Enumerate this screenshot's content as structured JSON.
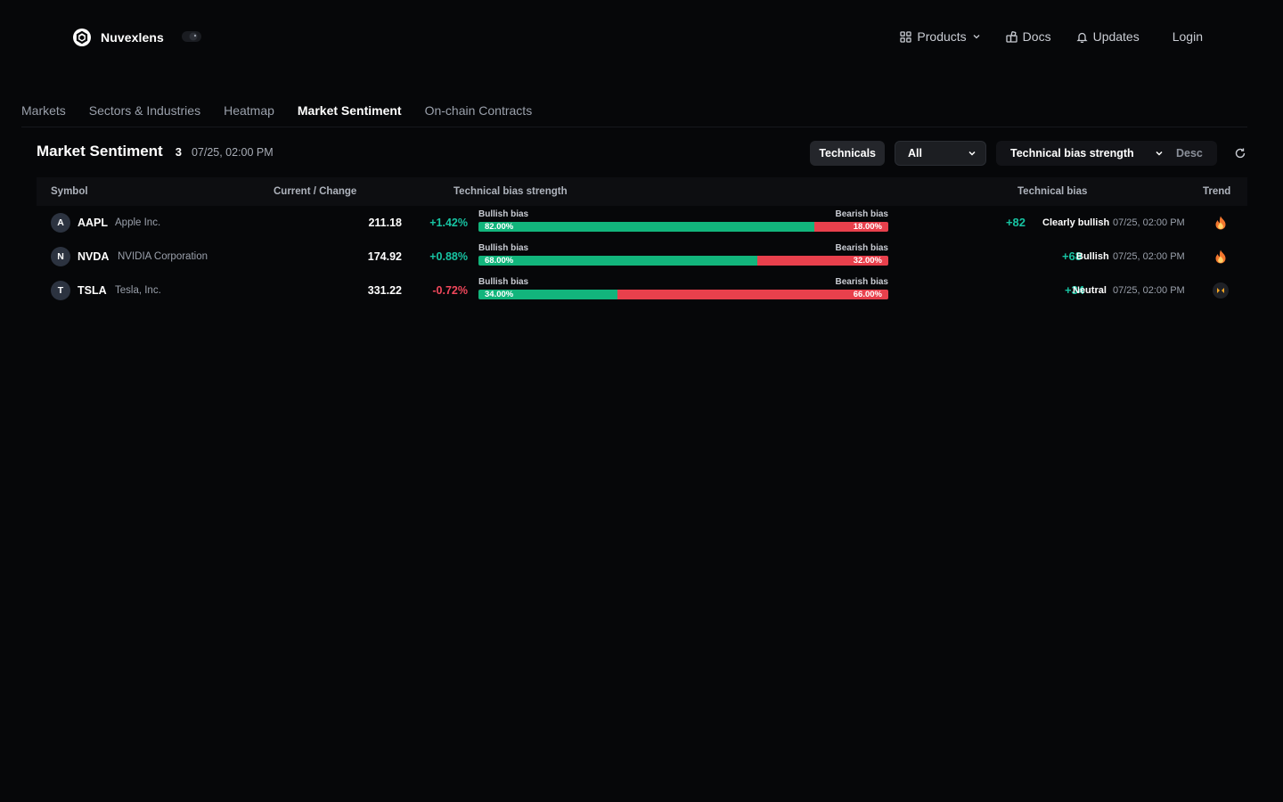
{
  "brand": {
    "name": "Nuvexlens"
  },
  "nav": {
    "products": "Products",
    "docs": "Docs",
    "updates": "Updates",
    "login": "Login"
  },
  "tabs": [
    {
      "label": "Markets",
      "active": false
    },
    {
      "label": "Sectors & Industries",
      "active": false
    },
    {
      "label": "Heatmap",
      "active": false
    },
    {
      "label": "Market Sentiment",
      "active": true
    },
    {
      "label": "On-chain Contracts",
      "active": false
    }
  ],
  "section": {
    "title": "Market Sentiment",
    "count": "3",
    "timestamp": "07/25, 02:00 PM"
  },
  "controls": {
    "technicals": "Technicals",
    "filter": "All",
    "sort_by": "Technical bias strength",
    "sort_dir": "Desc"
  },
  "columns": {
    "symbol": "Symbol",
    "current_change": "Current / Change",
    "bias_strength": "Technical bias strength",
    "bias": "Technical bias",
    "trend": "Trend"
  },
  "bias_labels": {
    "bullish": "Bullish bias",
    "bearish": "Bearish bias"
  },
  "rows": [
    {
      "initial": "A",
      "ticker": "AAPL",
      "company": "Apple Inc.",
      "price": "211.18",
      "change": "+1.42%",
      "change_dir": "up",
      "bullish_pct": 82.0,
      "bullish_label": "82.00%",
      "bearish_label": "18.00%",
      "score": "+82",
      "bias": "Clearly bullish",
      "time": "07/25, 02:00 PM",
      "trend_icon": "fire-icon"
    },
    {
      "initial": "N",
      "ticker": "NVDA",
      "company": "NVIDIA Corporation",
      "price": "174.92",
      "change": "+0.88%",
      "change_dir": "up",
      "bullish_pct": 68.0,
      "bullish_label": "68.00%",
      "bearish_label": "32.00%",
      "score": "+68",
      "bias": "Bullish",
      "time": "07/25, 02:00 PM",
      "trend_icon": "fire-icon"
    },
    {
      "initial": "T",
      "ticker": "TSLA",
      "company": "Tesla, Inc.",
      "price": "331.22",
      "change": "-0.72%",
      "change_dir": "down",
      "bullish_pct": 34.0,
      "bullish_label": "34.00%",
      "bearish_label": "66.00%",
      "score": "+34",
      "bias": "Neutral",
      "time": "07/25, 02:00 PM",
      "trend_icon": "neutral-arrows-icon"
    }
  ],
  "colors": {
    "background": "#060709",
    "positive": "#17c3a2",
    "negative": "#f0475b",
    "bull_bar": "#12b57c",
    "bear_bar": "#e8404c"
  }
}
